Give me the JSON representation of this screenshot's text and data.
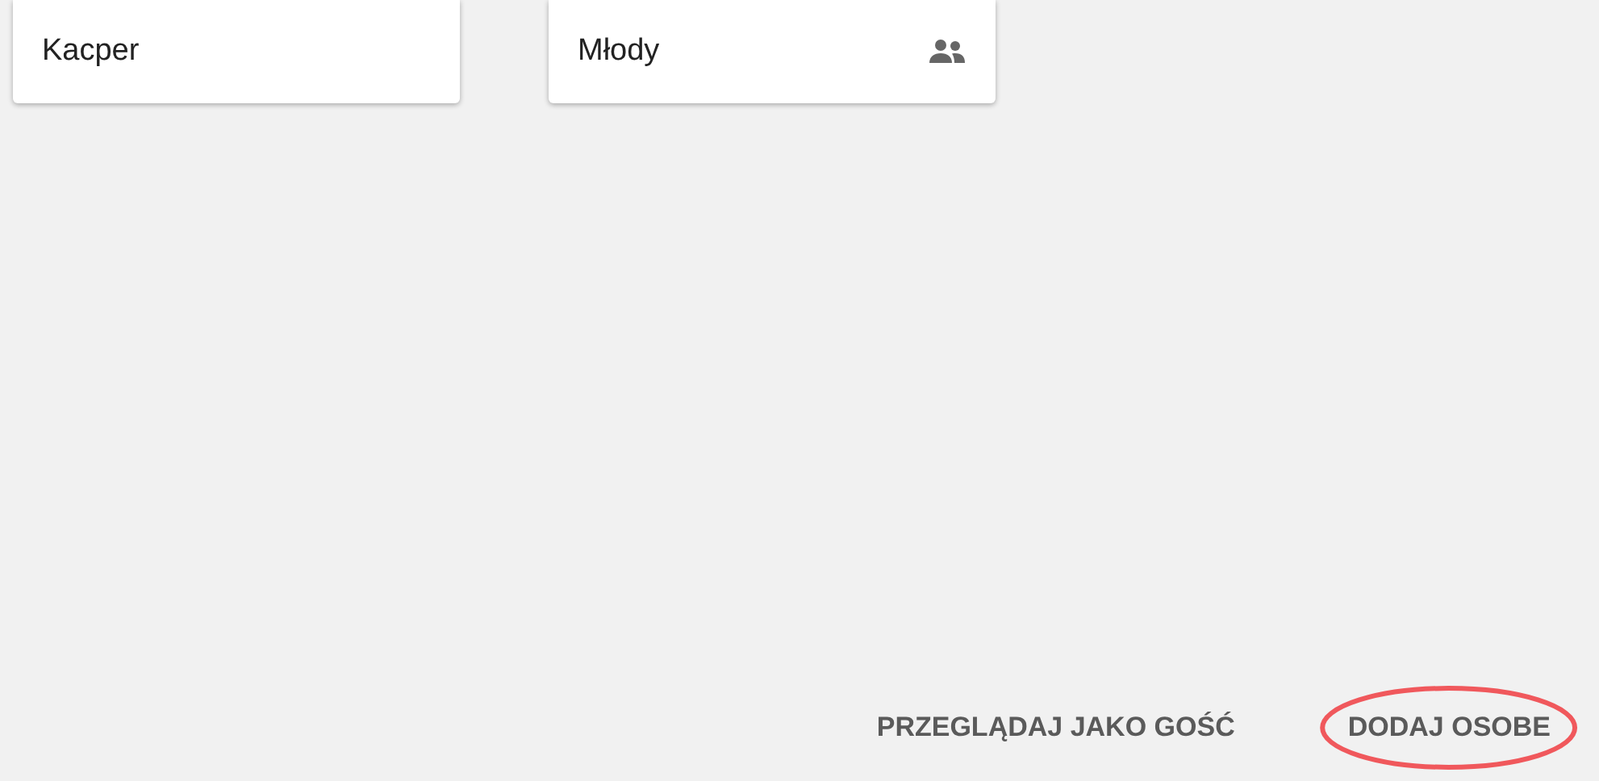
{
  "profiles": [
    {
      "name": "Kacper",
      "shared": false
    },
    {
      "name": "Młody",
      "shared": true
    }
  ],
  "actions": [
    {
      "label": "PRZEGLĄDAJ JAKO GOŚĆ",
      "circled": false
    },
    {
      "label": "DODAJ OSOBE",
      "circled": true
    }
  ]
}
